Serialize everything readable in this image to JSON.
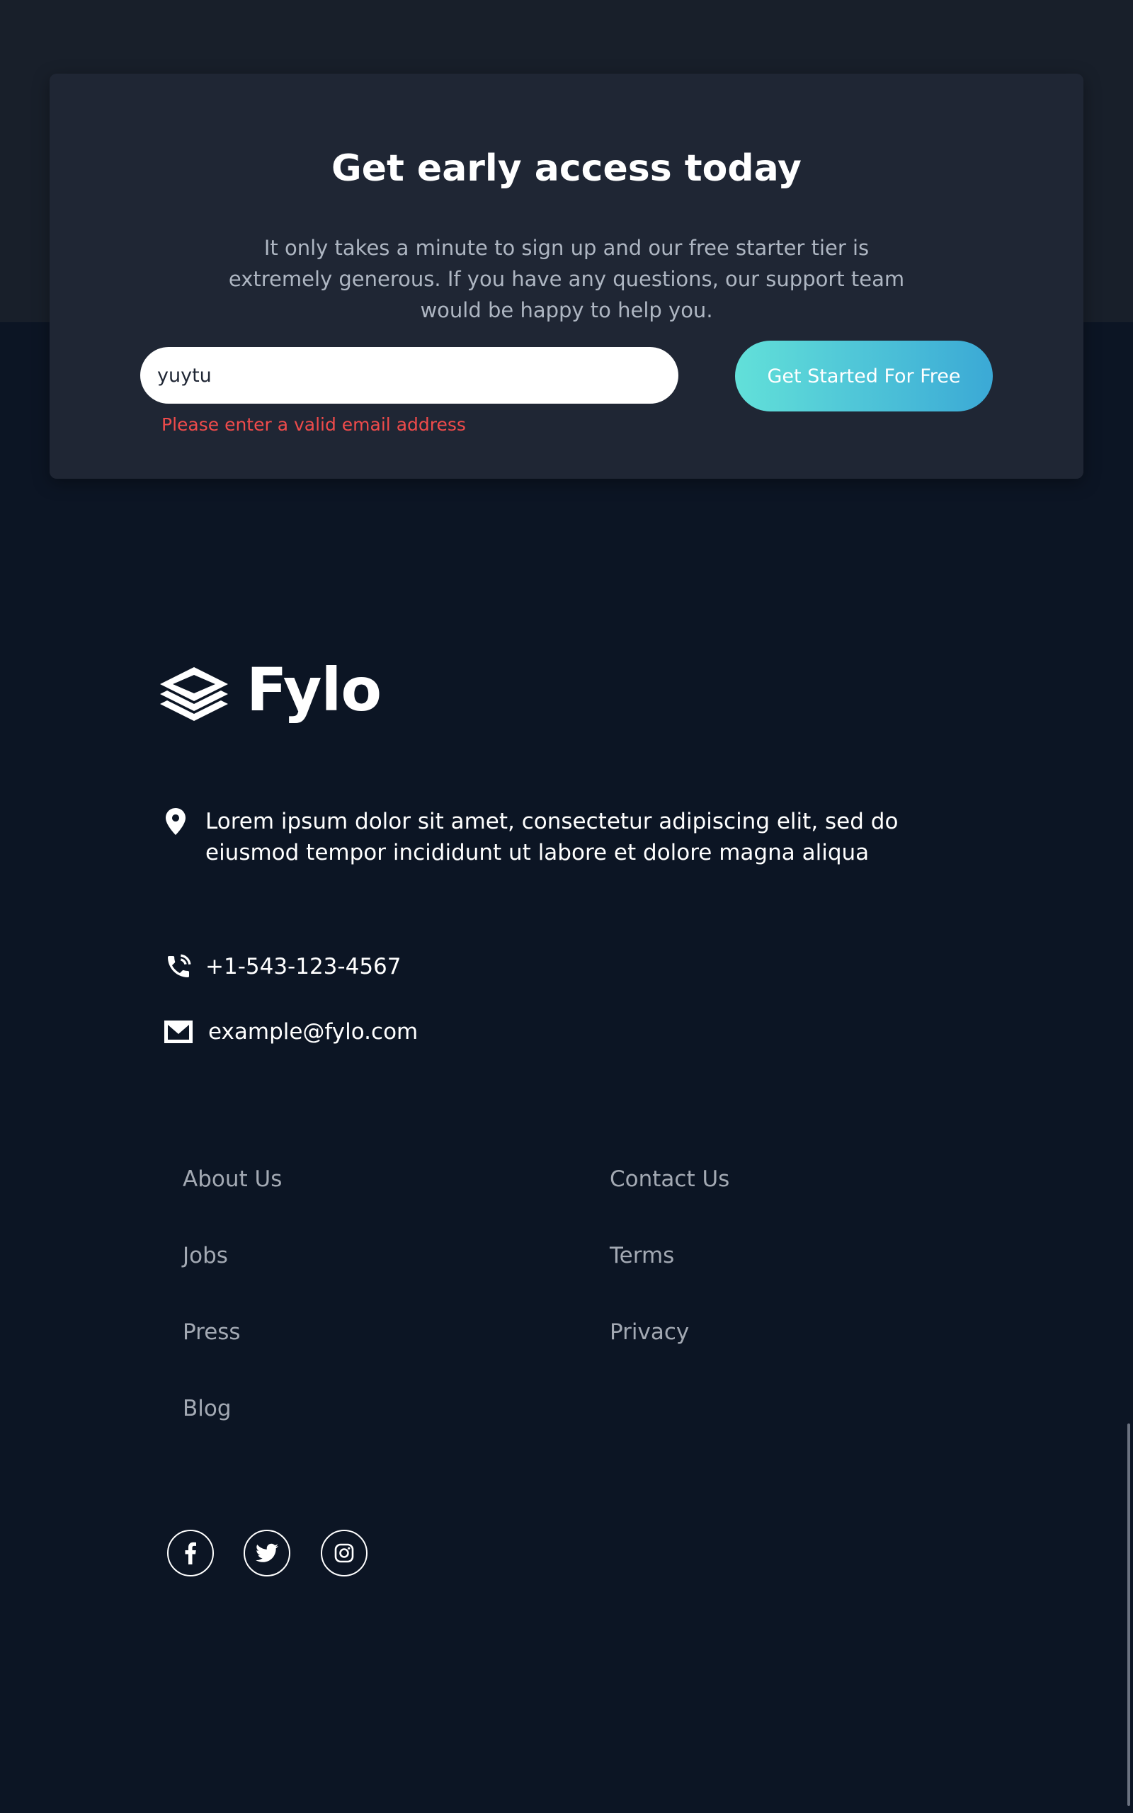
{
  "signup": {
    "title": "Get early access today",
    "description": "It only takes a minute to sign up and our free starter tier is extremely generous. If you have any questions, our support team would be happy to help you.",
    "email_value": "yuytu",
    "error_message": "Please enter a valid email address",
    "button_label": "Get Started For Free",
    "button_gradient": [
      "#62e0d9",
      "#3ba9d6"
    ],
    "error_color": "#ef4b4b"
  },
  "brand": {
    "name": "Fylo",
    "icon": "stacked-layers-logo-icon"
  },
  "contact": {
    "address": "Lorem ipsum dolor sit amet, consectetur adipiscing elit, sed do eiusmod tempor incididunt ut labore et dolore magna aliqua",
    "address_icon": "location-pin-icon",
    "phone": "+1-543-123-4567",
    "phone_icon": "phone-icon",
    "email": "example@fylo.com",
    "email_icon": "mail-icon"
  },
  "footer_links": {
    "column1": [
      "About Us",
      "Jobs",
      "Press",
      "Blog"
    ],
    "column2": [
      "Contact Us",
      "Terms",
      "Privacy"
    ]
  },
  "social": [
    {
      "name": "facebook",
      "icon": "facebook-icon"
    },
    {
      "name": "twitter",
      "icon": "twitter-icon"
    },
    {
      "name": "instagram",
      "icon": "instagram-icon"
    }
  ],
  "colors": {
    "page_background": "#0c1524",
    "top_band": "#181f2a",
    "card_background": "#1f2634",
    "muted_text": "#a3a9b3"
  }
}
